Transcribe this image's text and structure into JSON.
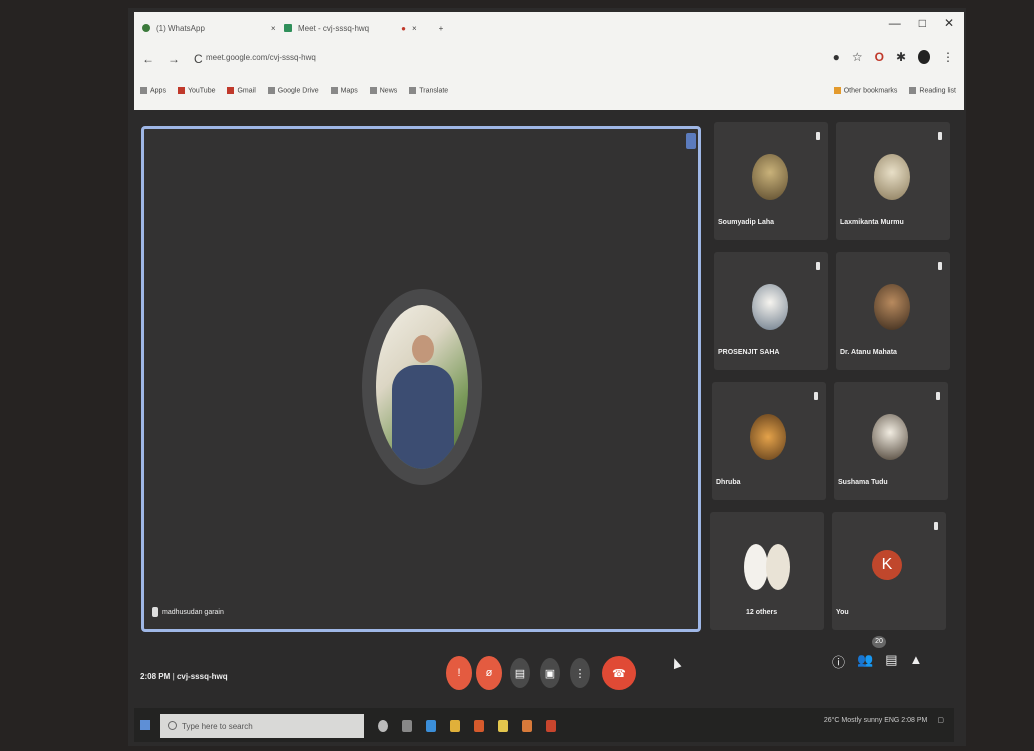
{
  "browser": {
    "tabs": [
      {
        "label": "(1) WhatsApp"
      },
      {
        "label": "Meet - cvj-sssq-hwq"
      }
    ],
    "window_controls": [
      "—",
      "□",
      "✕"
    ],
    "url": "meet.google.com/cvj-sssq-hwq",
    "bookmarks": [
      "Apps",
      "YouTube",
      "Gmail",
      "Google Drive",
      "Maps",
      "News",
      "Translate",
      "Other bookmarks",
      "Reading list"
    ]
  },
  "meeting": {
    "presenter_name": "madhusudan garain",
    "time": "2:08 PM",
    "code": "cvj-sssq-hwq",
    "participant_count": "20"
  },
  "participants": [
    {
      "name": "Soumyadip Laha"
    },
    {
      "name": "Laxmikanta Murmu"
    },
    {
      "name": "PROSENJIT SAHA"
    },
    {
      "name": "Dr. Atanu Mahata"
    },
    {
      "name": "Dhruba"
    },
    {
      "name": "Sushama Tudu"
    },
    {
      "name": "12 others"
    },
    {
      "name": "You",
      "initial": "K"
    }
  ],
  "taskbar": {
    "search_placeholder": "Type here to search",
    "tray_text": "26°C  Mostly sunny   ENG   2:08 PM"
  },
  "colors": {
    "end_call": "#e04a35",
    "mic_off": "#e45b40",
    "highlight": "#9fb7e6",
    "you_avatar": "#c0472c"
  }
}
